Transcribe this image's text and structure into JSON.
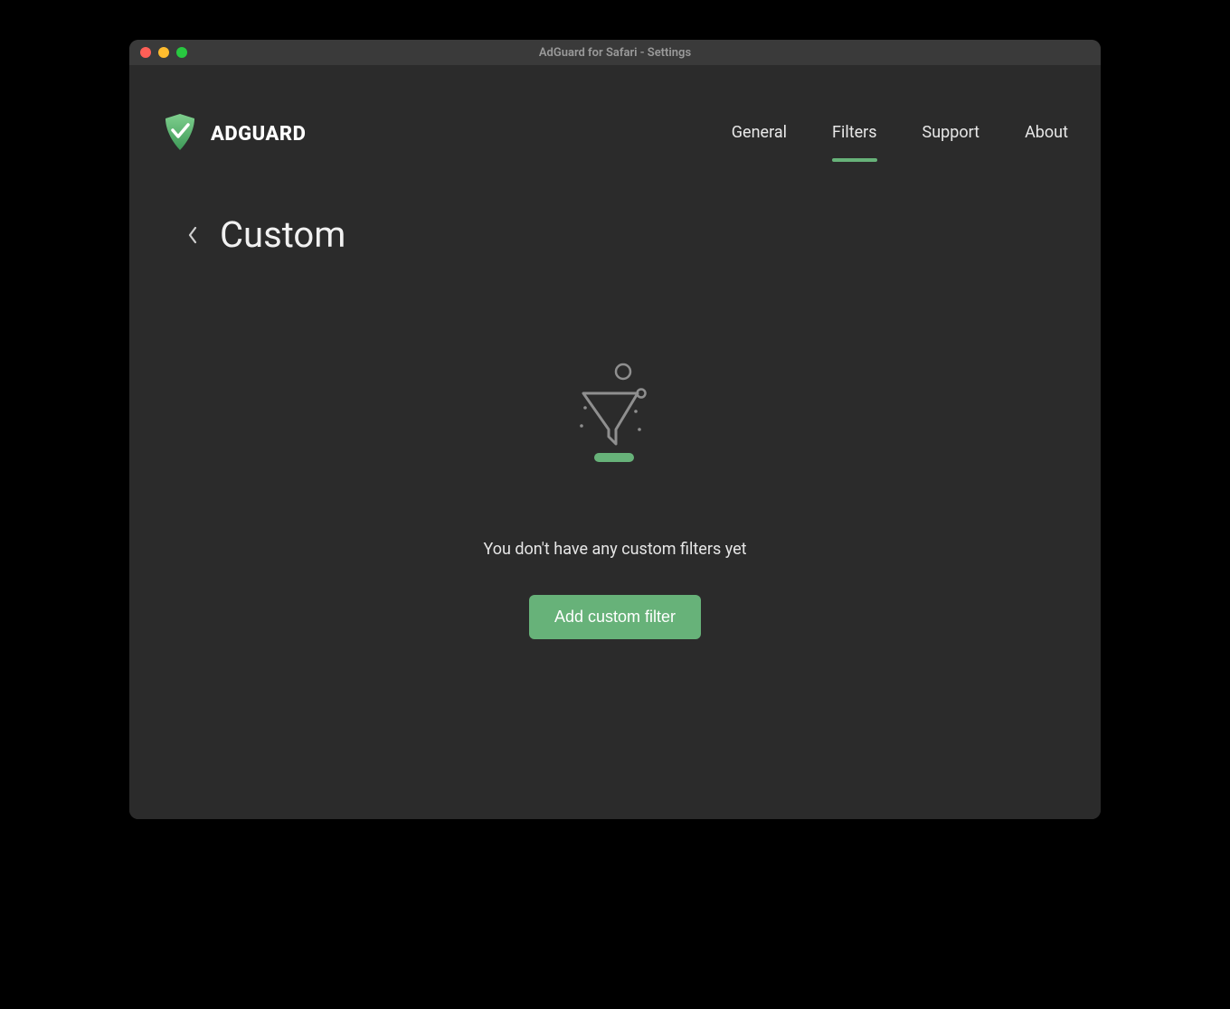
{
  "window": {
    "title": "AdGuard for Safari - Settings"
  },
  "brand": {
    "name": "ADGUARD"
  },
  "nav": {
    "items": [
      {
        "label": "General",
        "active": false
      },
      {
        "label": "Filters",
        "active": true
      },
      {
        "label": "Support",
        "active": false
      },
      {
        "label": "About",
        "active": false
      }
    ]
  },
  "page": {
    "title": "Custom"
  },
  "empty_state": {
    "message": "You don't have any custom filters yet",
    "button_label": "Add custom filter"
  },
  "colors": {
    "accent": "#67b279"
  }
}
